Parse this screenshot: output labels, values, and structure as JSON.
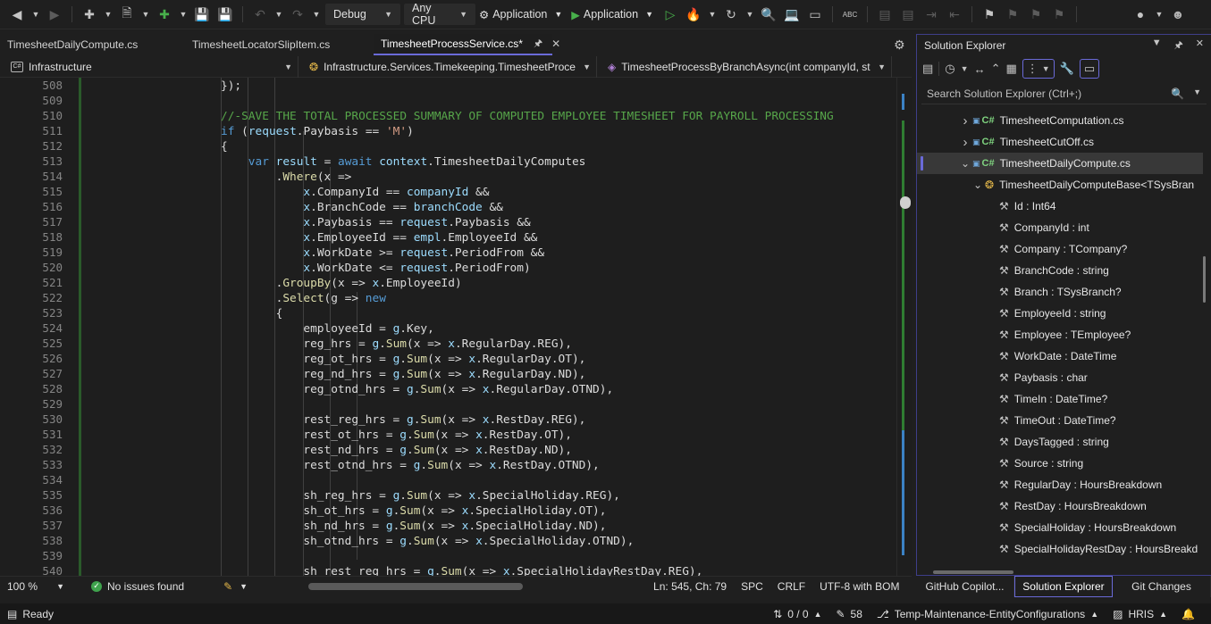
{
  "toolbar": {
    "config": "Debug",
    "platform": "Any CPU",
    "startup_project": "Application",
    "run_target": "Application"
  },
  "tabs": [
    {
      "label": "TimesheetDailyCompute.cs"
    },
    {
      "label": "TimesheetLocatorSlipItem.cs"
    },
    {
      "label": "TimesheetProcessService.cs*"
    }
  ],
  "navbar": {
    "project": "Infrastructure",
    "type": "Infrastructure.Services.Timekeeping.TimesheetProce",
    "member": "TimesheetProcessByBranchAsync(int companyId, st"
  },
  "lines": [
    "508",
    "509",
    "510",
    "511",
    "512",
    "513",
    "514",
    "515",
    "516",
    "517",
    "518",
    "519",
    "520",
    "521",
    "522",
    "523",
    "524",
    "525",
    "526",
    "527",
    "528",
    "529",
    "530",
    "531",
    "532",
    "533",
    "534",
    "535",
    "536",
    "537",
    "538",
    "539",
    "540"
  ],
  "code": [
    [
      {
        "t": "});",
        "c": "p"
      }
    ],
    [],
    [
      {
        "t": "//-SAVE THE TOTAL PROCESSED SUMMARY OF COMPUTED EMPLOYEE TIMESHEET FOR PAYROLL PROCESSING",
        "c": "c"
      }
    ],
    [
      {
        "t": "if",
        "c": "k"
      },
      {
        "t": " (",
        "c": "p"
      },
      {
        "t": "request",
        "c": "v"
      },
      {
        "t": ".Paybasis == ",
        "c": "p"
      },
      {
        "t": "'M'",
        "c": "s"
      },
      {
        "t": ")",
        "c": "p"
      }
    ],
    [
      {
        "t": "{",
        "c": "p"
      }
    ],
    [
      {
        "t": "var",
        "c": "k"
      },
      {
        "t": " result",
        "c": "v"
      },
      {
        "t": " = ",
        "c": "p"
      },
      {
        "t": "await",
        "c": "k"
      },
      {
        "t": " context",
        "c": "v"
      },
      {
        "t": ".TimesheetDailyComputes",
        "c": "p"
      }
    ],
    [
      {
        "t": ".",
        "c": "p"
      },
      {
        "t": "Where",
        "c": "m"
      },
      {
        "t": "(x =>",
        "c": "p"
      }
    ],
    [
      {
        "t": "x",
        "c": "v"
      },
      {
        "t": ".CompanyId == ",
        "c": "p"
      },
      {
        "t": "companyId",
        "c": "v"
      },
      {
        "t": " &&",
        "c": "p"
      }
    ],
    [
      {
        "t": "x",
        "c": "v"
      },
      {
        "t": ".BranchCode == ",
        "c": "p"
      },
      {
        "t": "branchCode",
        "c": "v"
      },
      {
        "t": " &&",
        "c": "p"
      }
    ],
    [
      {
        "t": "x",
        "c": "v"
      },
      {
        "t": ".Paybasis == ",
        "c": "p"
      },
      {
        "t": "request",
        "c": "v"
      },
      {
        "t": ".Paybasis &&",
        "c": "p"
      }
    ],
    [
      {
        "t": "x",
        "c": "v"
      },
      {
        "t": ".EmployeeId == ",
        "c": "p"
      },
      {
        "t": "empl",
        "c": "v"
      },
      {
        "t": ".EmployeeId &&",
        "c": "p"
      }
    ],
    [
      {
        "t": "x",
        "c": "v"
      },
      {
        "t": ".WorkDate >= ",
        "c": "p"
      },
      {
        "t": "request",
        "c": "v"
      },
      {
        "t": ".PeriodFrom &&",
        "c": "p"
      }
    ],
    [
      {
        "t": "x",
        "c": "v"
      },
      {
        "t": ".WorkDate <= ",
        "c": "p"
      },
      {
        "t": "request",
        "c": "v"
      },
      {
        "t": ".PeriodFrom)",
        "c": "p"
      }
    ],
    [
      {
        "t": ".",
        "c": "p"
      },
      {
        "t": "GroupBy",
        "c": "m"
      },
      {
        "t": "(x => ",
        "c": "p"
      },
      {
        "t": "x",
        "c": "v"
      },
      {
        "t": ".EmployeeId)",
        "c": "p"
      }
    ],
    [
      {
        "t": ".",
        "c": "p"
      },
      {
        "t": "Select",
        "c": "m"
      },
      {
        "t": "(g => ",
        "c": "p"
      },
      {
        "t": "new",
        "c": "k"
      }
    ],
    [
      {
        "t": "{",
        "c": "p"
      }
    ],
    [
      {
        "t": "employeeId = ",
        "c": "p"
      },
      {
        "t": "g",
        "c": "v"
      },
      {
        "t": ".Key,",
        "c": "p"
      }
    ],
    [
      {
        "t": "reg_hrs = ",
        "c": "p"
      },
      {
        "t": "g",
        "c": "v"
      },
      {
        "t": ".",
        "c": "p"
      },
      {
        "t": "Sum",
        "c": "m"
      },
      {
        "t": "(x => ",
        "c": "p"
      },
      {
        "t": "x",
        "c": "v"
      },
      {
        "t": ".RegularDay.REG),",
        "c": "p"
      }
    ],
    [
      {
        "t": "reg_ot_hrs = ",
        "c": "p"
      },
      {
        "t": "g",
        "c": "v"
      },
      {
        "t": ".",
        "c": "p"
      },
      {
        "t": "Sum",
        "c": "m"
      },
      {
        "t": "(x => ",
        "c": "p"
      },
      {
        "t": "x",
        "c": "v"
      },
      {
        "t": ".RegularDay.OT),",
        "c": "p"
      }
    ],
    [
      {
        "t": "reg_nd_hrs = ",
        "c": "p"
      },
      {
        "t": "g",
        "c": "v"
      },
      {
        "t": ".",
        "c": "p"
      },
      {
        "t": "Sum",
        "c": "m"
      },
      {
        "t": "(x => ",
        "c": "p"
      },
      {
        "t": "x",
        "c": "v"
      },
      {
        "t": ".RegularDay.ND),",
        "c": "p"
      }
    ],
    [
      {
        "t": "reg_otnd_hrs = ",
        "c": "p"
      },
      {
        "t": "g",
        "c": "v"
      },
      {
        "t": ".",
        "c": "p"
      },
      {
        "t": "Sum",
        "c": "m"
      },
      {
        "t": "(x => ",
        "c": "p"
      },
      {
        "t": "x",
        "c": "v"
      },
      {
        "t": ".RegularDay.OTND),",
        "c": "p"
      }
    ],
    [],
    [
      {
        "t": "rest_reg_hrs = ",
        "c": "p"
      },
      {
        "t": "g",
        "c": "v"
      },
      {
        "t": ".",
        "c": "p"
      },
      {
        "t": "Sum",
        "c": "m"
      },
      {
        "t": "(x => ",
        "c": "p"
      },
      {
        "t": "x",
        "c": "v"
      },
      {
        "t": ".RestDay.REG),",
        "c": "p"
      }
    ],
    [
      {
        "t": "rest_ot_hrs = ",
        "c": "p"
      },
      {
        "t": "g",
        "c": "v"
      },
      {
        "t": ".",
        "c": "p"
      },
      {
        "t": "Sum",
        "c": "m"
      },
      {
        "t": "(x => ",
        "c": "p"
      },
      {
        "t": "x",
        "c": "v"
      },
      {
        "t": ".RestDay.OT),",
        "c": "p"
      }
    ],
    [
      {
        "t": "rest_nd_hrs = ",
        "c": "p"
      },
      {
        "t": "g",
        "c": "v"
      },
      {
        "t": ".",
        "c": "p"
      },
      {
        "t": "Sum",
        "c": "m"
      },
      {
        "t": "(x => ",
        "c": "p"
      },
      {
        "t": "x",
        "c": "v"
      },
      {
        "t": ".RestDay.ND),",
        "c": "p"
      }
    ],
    [
      {
        "t": "rest_otnd_hrs = ",
        "c": "p"
      },
      {
        "t": "g",
        "c": "v"
      },
      {
        "t": ".",
        "c": "p"
      },
      {
        "t": "Sum",
        "c": "m"
      },
      {
        "t": "(x => ",
        "c": "p"
      },
      {
        "t": "x",
        "c": "v"
      },
      {
        "t": ".RestDay.OTND),",
        "c": "p"
      }
    ],
    [],
    [
      {
        "t": "sh_reg_hrs = ",
        "c": "p"
      },
      {
        "t": "g",
        "c": "v"
      },
      {
        "t": ".",
        "c": "p"
      },
      {
        "t": "Sum",
        "c": "m"
      },
      {
        "t": "(x => ",
        "c": "p"
      },
      {
        "t": "x",
        "c": "v"
      },
      {
        "t": ".SpecialHoliday.REG),",
        "c": "p"
      }
    ],
    [
      {
        "t": "sh_ot_hrs = ",
        "c": "p"
      },
      {
        "t": "g",
        "c": "v"
      },
      {
        "t": ".",
        "c": "p"
      },
      {
        "t": "Sum",
        "c": "m"
      },
      {
        "t": "(x => ",
        "c": "p"
      },
      {
        "t": "x",
        "c": "v"
      },
      {
        "t": ".SpecialHoliday.OT),",
        "c": "p"
      }
    ],
    [
      {
        "t": "sh_nd_hrs = ",
        "c": "p"
      },
      {
        "t": "g",
        "c": "v"
      },
      {
        "t": ".",
        "c": "p"
      },
      {
        "t": "Sum",
        "c": "m"
      },
      {
        "t": "(x => ",
        "c": "p"
      },
      {
        "t": "x",
        "c": "v"
      },
      {
        "t": ".SpecialHoliday.ND),",
        "c": "p"
      }
    ],
    [
      {
        "t": "sh_otnd_hrs = ",
        "c": "p"
      },
      {
        "t": "g",
        "c": "v"
      },
      {
        "t": ".",
        "c": "p"
      },
      {
        "t": "Sum",
        "c": "m"
      },
      {
        "t": "(x => ",
        "c": "p"
      },
      {
        "t": "x",
        "c": "v"
      },
      {
        "t": ".SpecialHoliday.OTND),",
        "c": "p"
      }
    ],
    [],
    [
      {
        "t": "sh_rest_reg_hrs = ",
        "c": "p"
      },
      {
        "t": "g",
        "c": "v"
      },
      {
        "t": ".",
        "c": "p"
      },
      {
        "t": "Sum",
        "c": "m"
      },
      {
        "t": "(x => ",
        "c": "p"
      },
      {
        "t": "x",
        "c": "v"
      },
      {
        "t": ".SpecialHolidayRestDay.REG),",
        "c": "p"
      }
    ]
  ],
  "editor_status": {
    "zoom": "100 %",
    "issues": "No issues found",
    "position": "Ln: 545, Ch: 79",
    "whitespace": "SPC",
    "line_ending": "CRLF",
    "encoding": "UTF-8 with BOM"
  },
  "solution_explorer": {
    "title": "Solution Explorer",
    "search_placeholder": "Search Solution Explorer (Ctrl+;)",
    "items": [
      {
        "label": "TimesheetComputation.cs",
        "kind": "file",
        "expanded": false
      },
      {
        "label": "TimesheetCutOff.cs",
        "kind": "file",
        "expanded": false
      },
      {
        "label": "TimesheetDailyCompute.cs",
        "kind": "file",
        "expanded": true,
        "selected": true
      },
      {
        "label": "TimesheetDailyComputeBase<TSysBran",
        "kind": "class",
        "expanded": true
      },
      {
        "label": "Id : Int64",
        "kind": "prop"
      },
      {
        "label": "CompanyId : int",
        "kind": "prop"
      },
      {
        "label": "Company : TCompany?",
        "kind": "prop"
      },
      {
        "label": "BranchCode : string",
        "kind": "prop"
      },
      {
        "label": "Branch : TSysBranch?",
        "kind": "prop"
      },
      {
        "label": "EmployeeId : string",
        "kind": "prop"
      },
      {
        "label": "Employee : TEmployee?",
        "kind": "prop"
      },
      {
        "label": "WorkDate : DateTime",
        "kind": "prop"
      },
      {
        "label": "Paybasis : char",
        "kind": "prop"
      },
      {
        "label": "TimeIn : DateTime?",
        "kind": "prop"
      },
      {
        "label": "TimeOut : DateTime?",
        "kind": "prop"
      },
      {
        "label": "DaysTagged : string",
        "kind": "prop"
      },
      {
        "label": "Source : string",
        "kind": "prop"
      },
      {
        "label": "RegularDay : HoursBreakdown",
        "kind": "prop"
      },
      {
        "label": "RestDay : HoursBreakdown",
        "kind": "prop"
      },
      {
        "label": "SpecialHoliday : HoursBreakdown",
        "kind": "prop"
      },
      {
        "label": "SpecialHolidayRestDay : HoursBreakd",
        "kind": "prop"
      }
    ]
  },
  "bottom_tabs": [
    {
      "label": "GitHub Copilot..."
    },
    {
      "label": "Solution Explorer"
    },
    {
      "label": "Git Changes"
    }
  ],
  "status": {
    "ready": "Ready",
    "sync": "0 / 0",
    "edits": "58",
    "branch": "Temp-Maintenance-EntityConfigurations",
    "repo": "HRIS"
  }
}
